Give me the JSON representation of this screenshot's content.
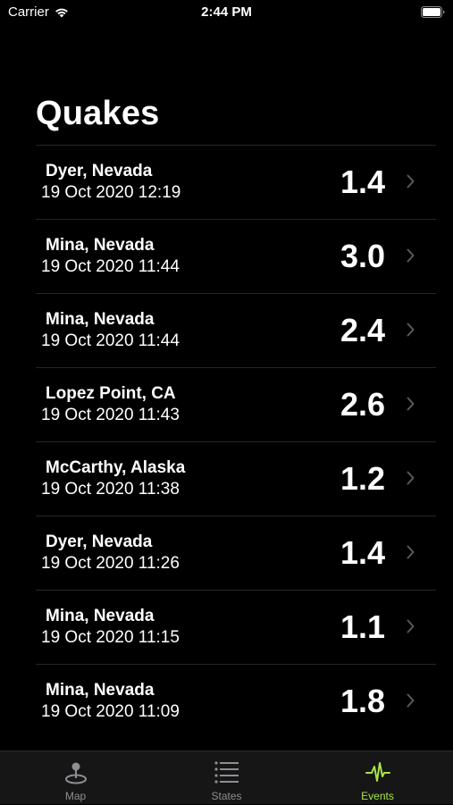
{
  "status_bar": {
    "carrier": "Carrier",
    "time": "2:44 PM"
  },
  "title": "Quakes",
  "quakes": [
    {
      "place": "Dyer, Nevada",
      "time": "19 Oct 2020 12:19",
      "magnitude": "1.4"
    },
    {
      "place": "Mina, Nevada",
      "time": "19 Oct 2020 11:44",
      "magnitude": "3.0"
    },
    {
      "place": "Mina, Nevada",
      "time": "19 Oct 2020 11:44",
      "magnitude": "2.4"
    },
    {
      "place": "Lopez Point, CA",
      "time": "19 Oct 2020 11:43",
      "magnitude": "2.6"
    },
    {
      "place": "McCarthy, Alaska",
      "time": "19 Oct 2020 11:38",
      "magnitude": "1.2"
    },
    {
      "place": "Dyer, Nevada",
      "time": "19 Oct 2020 11:26",
      "magnitude": "1.4"
    },
    {
      "place": "Mina, Nevada",
      "time": "19 Oct 2020 11:15",
      "magnitude": "1.1"
    },
    {
      "place": "Mina, Nevada",
      "time": "19 Oct 2020 11:09",
      "magnitude": "1.8"
    }
  ],
  "tab_bar": {
    "tabs": [
      {
        "label": "Map",
        "icon": "map-pin-icon",
        "active": false
      },
      {
        "label": "States",
        "icon": "list-icon",
        "active": false
      },
      {
        "label": "Events",
        "icon": "activity-pulse-icon",
        "active": true
      }
    ]
  },
  "colors": {
    "background": "#000000",
    "accent": "#a7e34a",
    "inactive_tab": "#8e8e93",
    "chevron": "#5a5a5e"
  }
}
